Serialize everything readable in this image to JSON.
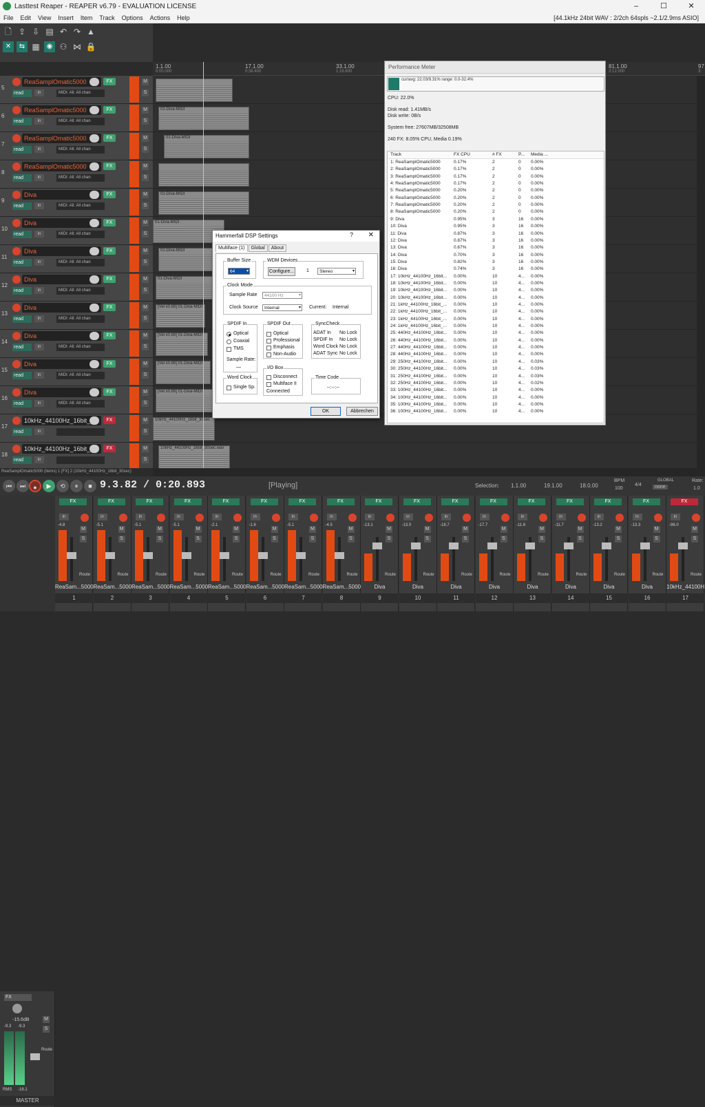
{
  "window": {
    "title": "Lasttest Reaper - REAPER v6.79 - EVALUATION LICENSE",
    "min": "–",
    "max": "☐",
    "close": "✕"
  },
  "menu": {
    "items": [
      "File",
      "Edit",
      "View",
      "Insert",
      "Item",
      "Track",
      "Options",
      "Actions",
      "Help"
    ],
    "status": "[44.1kHz 24bit WAV : 2/2ch 64spls ~2.1/2.9ms ASIO]"
  },
  "ruler": {
    "marks": [
      {
        "label": "1.1.00",
        "sub": "0:00.000"
      },
      {
        "label": "17.1.00",
        "sub": "0:38.400"
      },
      {
        "label": "33.1.00",
        "sub": "1:16.800"
      },
      {
        "label": "49.1.00",
        "sub": "1:55.200"
      },
      {
        "label": "65.1.00",
        "sub": "2:33.600"
      },
      {
        "label": "81.1.00",
        "sub": "3:12.000"
      },
      {
        "label": "97",
        "sub": "3:"
      }
    ]
  },
  "tracks": [
    {
      "num": "5",
      "name": "ReaSamplOmatic5000",
      "midi": "MIDI: All: All chan",
      "fx": "FX"
    },
    {
      "num": "6",
      "name": "ReaSamplOmatic5000",
      "midi": "MIDI: All: All chan",
      "fx": "FX"
    },
    {
      "num": "7",
      "name": "ReaSamplOmatic5000",
      "midi": "MIDI: All: All chan",
      "fx": "FX"
    },
    {
      "num": "8",
      "name": "ReaSamplOmatic5000",
      "midi": "MIDI: All: All chan",
      "fx": "FX"
    },
    {
      "num": "9",
      "name": "Diva",
      "midi": "MIDI: All: All chan",
      "fx": "FX"
    },
    {
      "num": "10",
      "name": "Diva",
      "midi": "MIDI: All: All chan",
      "fx": "FX"
    },
    {
      "num": "11",
      "name": "Diva",
      "midi": "MIDI: All: All chan",
      "fx": "FX"
    },
    {
      "num": "12",
      "name": "Diva",
      "midi": "MIDI: All: All chan",
      "fx": "FX"
    },
    {
      "num": "13",
      "name": "Diva",
      "midi": "MIDI: All: All chan",
      "fx": "FX"
    },
    {
      "num": "14",
      "name": "Diva",
      "midi": "MIDI: All: All chan",
      "fx": "FX"
    },
    {
      "num": "15",
      "name": "Diva",
      "midi": "MIDI: All: All chan",
      "fx": "FX"
    },
    {
      "num": "16",
      "name": "Diva",
      "midi": "MIDI: All: All chan",
      "fx": "FX"
    },
    {
      "num": "17",
      "name": "10kHz_44100Hz_16bit_3",
      "midi": "",
      "fx": "FX"
    },
    {
      "num": "18",
      "name": "10kHz_44100Hz_16bit_3",
      "midi": "",
      "fx": "FX"
    }
  ],
  "track_labels": {
    "read": "read",
    "in": "in",
    "m": "M",
    "s": "S"
  },
  "items": [
    {
      "label": "",
      "row": 0
    },
    {
      "label": "01-Diva-MIDI",
      "row": 1
    },
    {
      "label": "01-Diva-MIDI",
      "row": 2
    },
    {
      "label": "",
      "row": 3
    },
    {
      "label": "01-Diva-MIDI",
      "row": 4
    },
    {
      "label": "01-Diva-MIDI",
      "row": 5
    },
    {
      "label": "01-Diva-MIDI",
      "row": 6
    },
    {
      "label": "01-Diva-MIDI",
      "row": 7
    },
    {
      "label": "[Vel x0.89] 01-Diva-MIDI",
      "row": 8
    },
    {
      "label": "[Vel x0.89] 01-Diva-MIDI",
      "row": 9
    },
    {
      "label": "[Vel x0.89] 01-Diva-MIDI",
      "row": 10
    },
    {
      "label": "[Vel x0.89] 01-Diva-MIDI",
      "row": 11
    },
    {
      "label": "10kHz_44100Hz_16bit_30sec",
      "row": 12
    },
    {
      "label": "10kHz_44100Hz_16bit_30sec.wav",
      "row": 13
    },
    {
      "label": "10kHz_44100Hz_16bit_30sec",
      "row": 14
    }
  ],
  "statusline": "ReaSamplOmatic5000 (items) 1 [FX] 2 (10kHz_44100Hz_16bit_30sec)",
  "transport": {
    "time": "9.3.82 / 0:20.893",
    "state": "[Playing]",
    "selection_label": "Selection:",
    "sel_start": "1.1.00",
    "sel_end": "19.1.00",
    "sel_len": "18.0.00",
    "bpm_label": "BPM",
    "bpm": "100",
    "sig": "4/4",
    "global_label": "GLOBAL",
    "global_val": "none",
    "rate_label": "Rate:",
    "rate": "1.0"
  },
  "master": {
    "label": "MASTER",
    "fx": "FX",
    "peak": "-15.6dB",
    "l": "-9.3",
    "r": "-9.3",
    "rms": "RMS",
    "rms_val": "-16.1",
    "route": "Route"
  },
  "mixer_strips": [
    {
      "name": "ReaSam...5000",
      "num": "1",
      "peak": "-4.8"
    },
    {
      "name": "ReaSam...5000",
      "num": "2",
      "peak": "-5.1"
    },
    {
      "name": "ReaSam...5000",
      "num": "3",
      "peak": "-5.1"
    },
    {
      "name": "ReaSam...5000",
      "num": "4",
      "peak": "-5.1"
    },
    {
      "name": "ReaSam...5000",
      "num": "5",
      "peak": "-2.1"
    },
    {
      "name": "ReaSam...5000",
      "num": "6",
      "peak": "-1.6"
    },
    {
      "name": "ReaSam...5000",
      "num": "7",
      "peak": "-5.1"
    },
    {
      "name": "ReaSam...5000",
      "num": "8",
      "peak": "-4.5"
    },
    {
      "name": "Diva",
      "num": "9",
      "peak": "-13.1"
    },
    {
      "name": "Diva",
      "num": "10",
      "peak": "-13.0"
    },
    {
      "name": "Diva",
      "num": "11",
      "peak": "-18.7"
    },
    {
      "name": "Diva",
      "num": "12",
      "peak": "-17.7"
    },
    {
      "name": "Diva",
      "num": "13",
      "peak": "-11.6"
    },
    {
      "name": "Diva",
      "num": "14",
      "peak": "-11.7"
    },
    {
      "name": "Diva",
      "num": "15",
      "peak": "-13.2"
    },
    {
      "name": "Diva",
      "num": "16",
      "peak": "-13.3"
    },
    {
      "name": "10kHz_44100H",
      "num": "17",
      "peak": "-96.0"
    }
  ],
  "perf": {
    "title": "Performance Meter",
    "graph": "cur/avg: 22.03/9.31%  range: 0.0-32.4%",
    "cpu": "CPU: 22.0%",
    "disk_read": "Disk read: 1.41MB/s",
    "disk_write": "Disk write: 0B/s",
    "sys_free": "System free: 27607MB/32508MB",
    "fx_summary": "240 FX: 8.05% CPU, Media 0.19%",
    "headers": [
      "Track",
      "FX CPU",
      "# FX",
      "P...",
      "Media ..."
    ],
    "rows": [
      [
        "1: ReaSamplOmatic5000",
        "0.17%",
        "2",
        "0",
        "0.00%"
      ],
      [
        "2: ReaSamplOmatic5000",
        "0.17%",
        "2",
        "0",
        "0.00%"
      ],
      [
        "3: ReaSamplOmatic5000",
        "0.17%",
        "2",
        "0",
        "0.00%"
      ],
      [
        "4: ReaSamplOmatic5000",
        "0.17%",
        "2",
        "0",
        "0.00%"
      ],
      [
        "5: ReaSamplOmatic5000",
        "0.20%",
        "2",
        "0",
        "0.00%"
      ],
      [
        "6: ReaSamplOmatic5000",
        "0.20%",
        "2",
        "0",
        "0.00%"
      ],
      [
        "7: ReaSamplOmatic5000",
        "0.20%",
        "2",
        "0",
        "0.00%"
      ],
      [
        "8: ReaSamplOmatic5000",
        "0.20%",
        "2",
        "0",
        "0.00%"
      ],
      [
        "9: Diva",
        "0.95%",
        "3",
        "16",
        "0.00%"
      ],
      [
        "10: Diva",
        "0.95%",
        "3",
        "16",
        "0.00%"
      ],
      [
        "11: Diva",
        "0.87%",
        "3",
        "16",
        "0.00%"
      ],
      [
        "12: Diva",
        "0.87%",
        "3",
        "16",
        "0.00%"
      ],
      [
        "13: Diva",
        "0.67%",
        "3",
        "16",
        "0.00%"
      ],
      [
        "14: Diva",
        "0.70%",
        "3",
        "16",
        "0.00%"
      ],
      [
        "15: Diva",
        "0.82%",
        "3",
        "16",
        "0.00%"
      ],
      [
        "16: Diva",
        "0.74%",
        "3",
        "16",
        "0.00%"
      ],
      [
        "17: 10kHz_44100Hz_16bit...",
        "0.00%",
        "10",
        "4...",
        "0.00%"
      ],
      [
        "18: 10kHz_44100Hz_16bit...",
        "0.00%",
        "10",
        "4...",
        "0.00%"
      ],
      [
        "19: 10kHz_44100Hz_16bit...",
        "0.00%",
        "10",
        "4...",
        "0.00%"
      ],
      [
        "20: 10kHz_44100Hz_16bit...",
        "0.00%",
        "10",
        "4...",
        "0.00%"
      ],
      [
        "21: 1kHz_44100Hz_16bit_...",
        "0.00%",
        "10",
        "4...",
        "0.00%"
      ],
      [
        "22: 1kHz_44100Hz_16bit_...",
        "0.00%",
        "10",
        "4...",
        "0.00%"
      ],
      [
        "23: 1kHz_44100Hz_16bit_...",
        "0.00%",
        "10",
        "4...",
        "0.00%"
      ],
      [
        "24: 1kHz_44100Hz_16bit_...",
        "0.00%",
        "10",
        "4...",
        "0.00%"
      ],
      [
        "25: 440Hz_44100Hz_16bit...",
        "0.00%",
        "10",
        "4...",
        "0.00%"
      ],
      [
        "26: 440Hz_44100Hz_16bit...",
        "0.00%",
        "10",
        "4...",
        "0.00%"
      ],
      [
        "27: 440Hz_44100Hz_16bit...",
        "0.00%",
        "10",
        "4...",
        "0.00%"
      ],
      [
        "28: 440Hz_44100Hz_16bit...",
        "0.00%",
        "10",
        "4...",
        "0.00%"
      ],
      [
        "29: 250Hz_44100Hz_16bit...",
        "0.00%",
        "10",
        "4...",
        "0.03%"
      ],
      [
        "30: 250Hz_44100Hz_16bit...",
        "0.00%",
        "10",
        "4...",
        "0.03%"
      ],
      [
        "31: 250Hz_44100Hz_16bit...",
        "0.00%",
        "10",
        "4...",
        "0.03%"
      ],
      [
        "32: 250Hz_44100Hz_16bit...",
        "0.00%",
        "10",
        "4...",
        "0.02%"
      ],
      [
        "33: 100Hz_44100Hz_16bit...",
        "0.00%",
        "10",
        "4...",
        "0.00%"
      ],
      [
        "34: 100Hz_44100Hz_16bit...",
        "0.00%",
        "10",
        "4...",
        "0.00%"
      ],
      [
        "35: 100Hz_44100Hz_16bit...",
        "0.00%",
        "10",
        "4...",
        "0.00%"
      ],
      [
        "36: 100Hz_44100Hz_16bit...",
        "0.00%",
        "10",
        "4...",
        "0.00%"
      ]
    ]
  },
  "dialog": {
    "title": "Hammerfall DSP Settings",
    "help": "?",
    "close": "✕",
    "tabs": [
      "Multiface (1)",
      "Global",
      "About"
    ],
    "buffer_size_label": "Buffer Size",
    "buffer_size": "64",
    "wdm_label": "WDM Devices",
    "configure": "Configure...",
    "wdm_count": "1",
    "wdm_mode": "Stereo",
    "clock_mode_label": "Clock Mode",
    "sample_rate_label": "Sample Rate",
    "sample_rate": "44100 Hz",
    "clock_source_label": "Clock Source",
    "clock_source": "Internal",
    "current_label": "Current:",
    "current": "Internal",
    "spdif_in_label": "SPDIF In",
    "optical": "Optical",
    "coaxial": "Coaxial",
    "tms": "TMS",
    "sample_rate_small": "Sample Rate:",
    "sample_rate_val": "—",
    "spdif_out_label": "SPDIF Out",
    "out_optical": "Optical",
    "professional": "Professional",
    "emphasis": "Emphasis",
    "non_audio": "Non-Audio",
    "synccheck_label": "SyncCheck",
    "sync_rows": [
      [
        "ADAT In",
        "No Lock"
      ],
      [
        "SPDIF In",
        "No Lock"
      ],
      [
        "Word Clock",
        "No Lock"
      ],
      [
        "ADAT Sync",
        "No Lock"
      ]
    ],
    "wordclock_label": "Word Clock",
    "single_sp": "Single Sp.",
    "iobox_label": "I/O Box",
    "disconnect": "Disconnect",
    "multiface2": "Multiface II",
    "connected": "Connected",
    "timecode_label": "Time Code",
    "timecode": "--:--:--",
    "ok": "OK",
    "cancel": "Abbrechen"
  }
}
